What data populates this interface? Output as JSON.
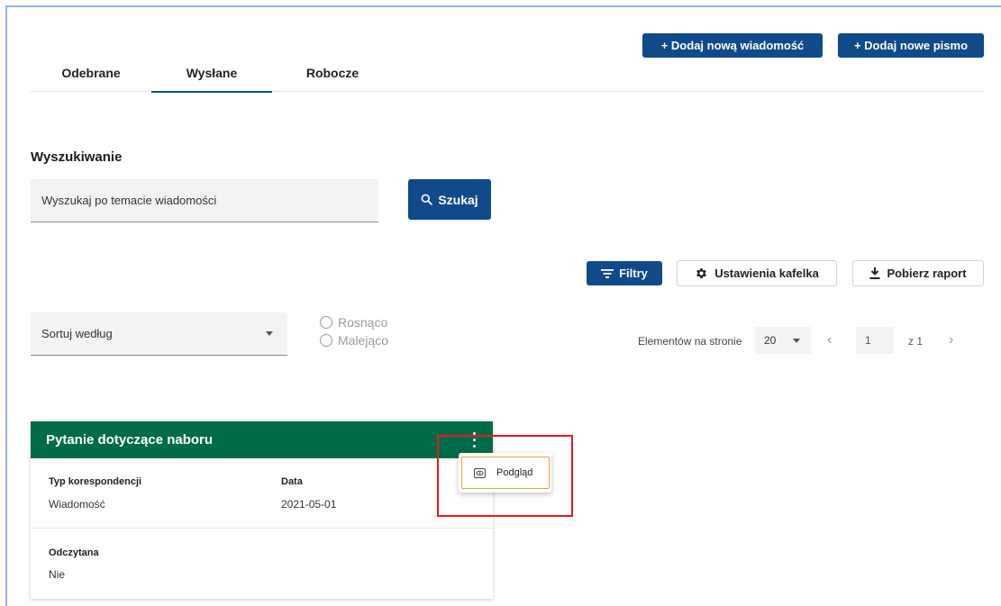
{
  "tabs": [
    {
      "label": "Odebrane"
    },
    {
      "label": "Wysłane"
    },
    {
      "label": "Robocze"
    }
  ],
  "header_buttons": {
    "new_message": "+ Dodaj nową wiadomość",
    "new_letter": "+ Dodaj nowe pismo"
  },
  "search": {
    "heading": "Wyszukiwanie",
    "placeholder": "Wyszukaj po temacie wiadomości",
    "button": "Szukaj"
  },
  "toolbar": {
    "filters": "Filtry",
    "tile_settings": "Ustawienia kafelka",
    "download_report": "Pobierz raport"
  },
  "sort": {
    "label": "Sortuj według",
    "ascending": "Rosnąco",
    "descending": "Malejąco"
  },
  "pagination": {
    "items_per_page_label": "Elementów na stronie",
    "items_per_page": "20",
    "current_page": "1",
    "total_pages_text": "z 1"
  },
  "card": {
    "title": "Pytanie dotyczące naboru",
    "type_label": "Typ korespondencji",
    "type_value": "Wiadomość",
    "date_label": "Data",
    "date_value": "2021-05-01",
    "read_label": "Odczytana",
    "read_value": "Nie"
  },
  "context_menu": {
    "preview": "Podgląd"
  },
  "colors": {
    "primary": "#0f4a8a",
    "card_header": "#006b48",
    "highlight": "#e31b1b",
    "menu_focus": "#e8a23c"
  },
  "icons": [
    "search-icon",
    "filter-icon",
    "gear-icon",
    "download-icon",
    "kebab-menu-icon",
    "eye-icon",
    "chevron-left-icon",
    "chevron-right-icon",
    "caret-down-icon"
  ]
}
